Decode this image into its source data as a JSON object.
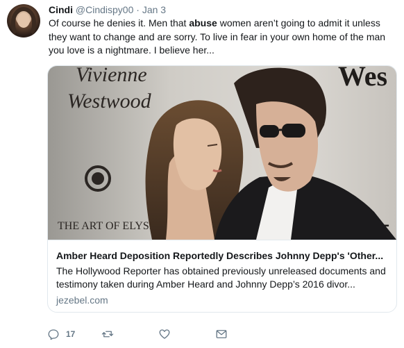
{
  "tweet": {
    "author_name": "Cindi",
    "handle": "@Cindispy00",
    "separator": "·",
    "date": "Jan 3",
    "text_before": "Of course he denies it. Men that ",
    "text_bold": "abuse",
    "text_after": " women aren’t going to admit it unless they want to change and are sorry. To live in fear in your own home of the man you love is a nightmare. I believe her..."
  },
  "card": {
    "image_alt": "Amber Heard and Johnny Depp at a Vivienne Westwood event",
    "backdrop_text": {
      "brand_line1": "Vivienne",
      "brand_line2": "Westwood",
      "art_of": "THE ART OF ELYSI",
      "right_top": "Wes",
      "right_bottom": "RT"
    },
    "title": "Amber Heard Deposition Reportedly Describes Johnny Depp's 'Other...",
    "description": "The Hollywood Reporter has obtained previously unreleased documents and testimony taken during Amber Heard and Johnny Depp’s 2016 divor...",
    "domain": "jezebel.com"
  },
  "actions": {
    "reply_count": "17",
    "icons": [
      "reply-icon",
      "retweet-icon",
      "like-icon",
      "message-icon"
    ]
  },
  "colors": {
    "text": "#14171a",
    "muted": "#657786",
    "border": "#e1e8ed"
  }
}
